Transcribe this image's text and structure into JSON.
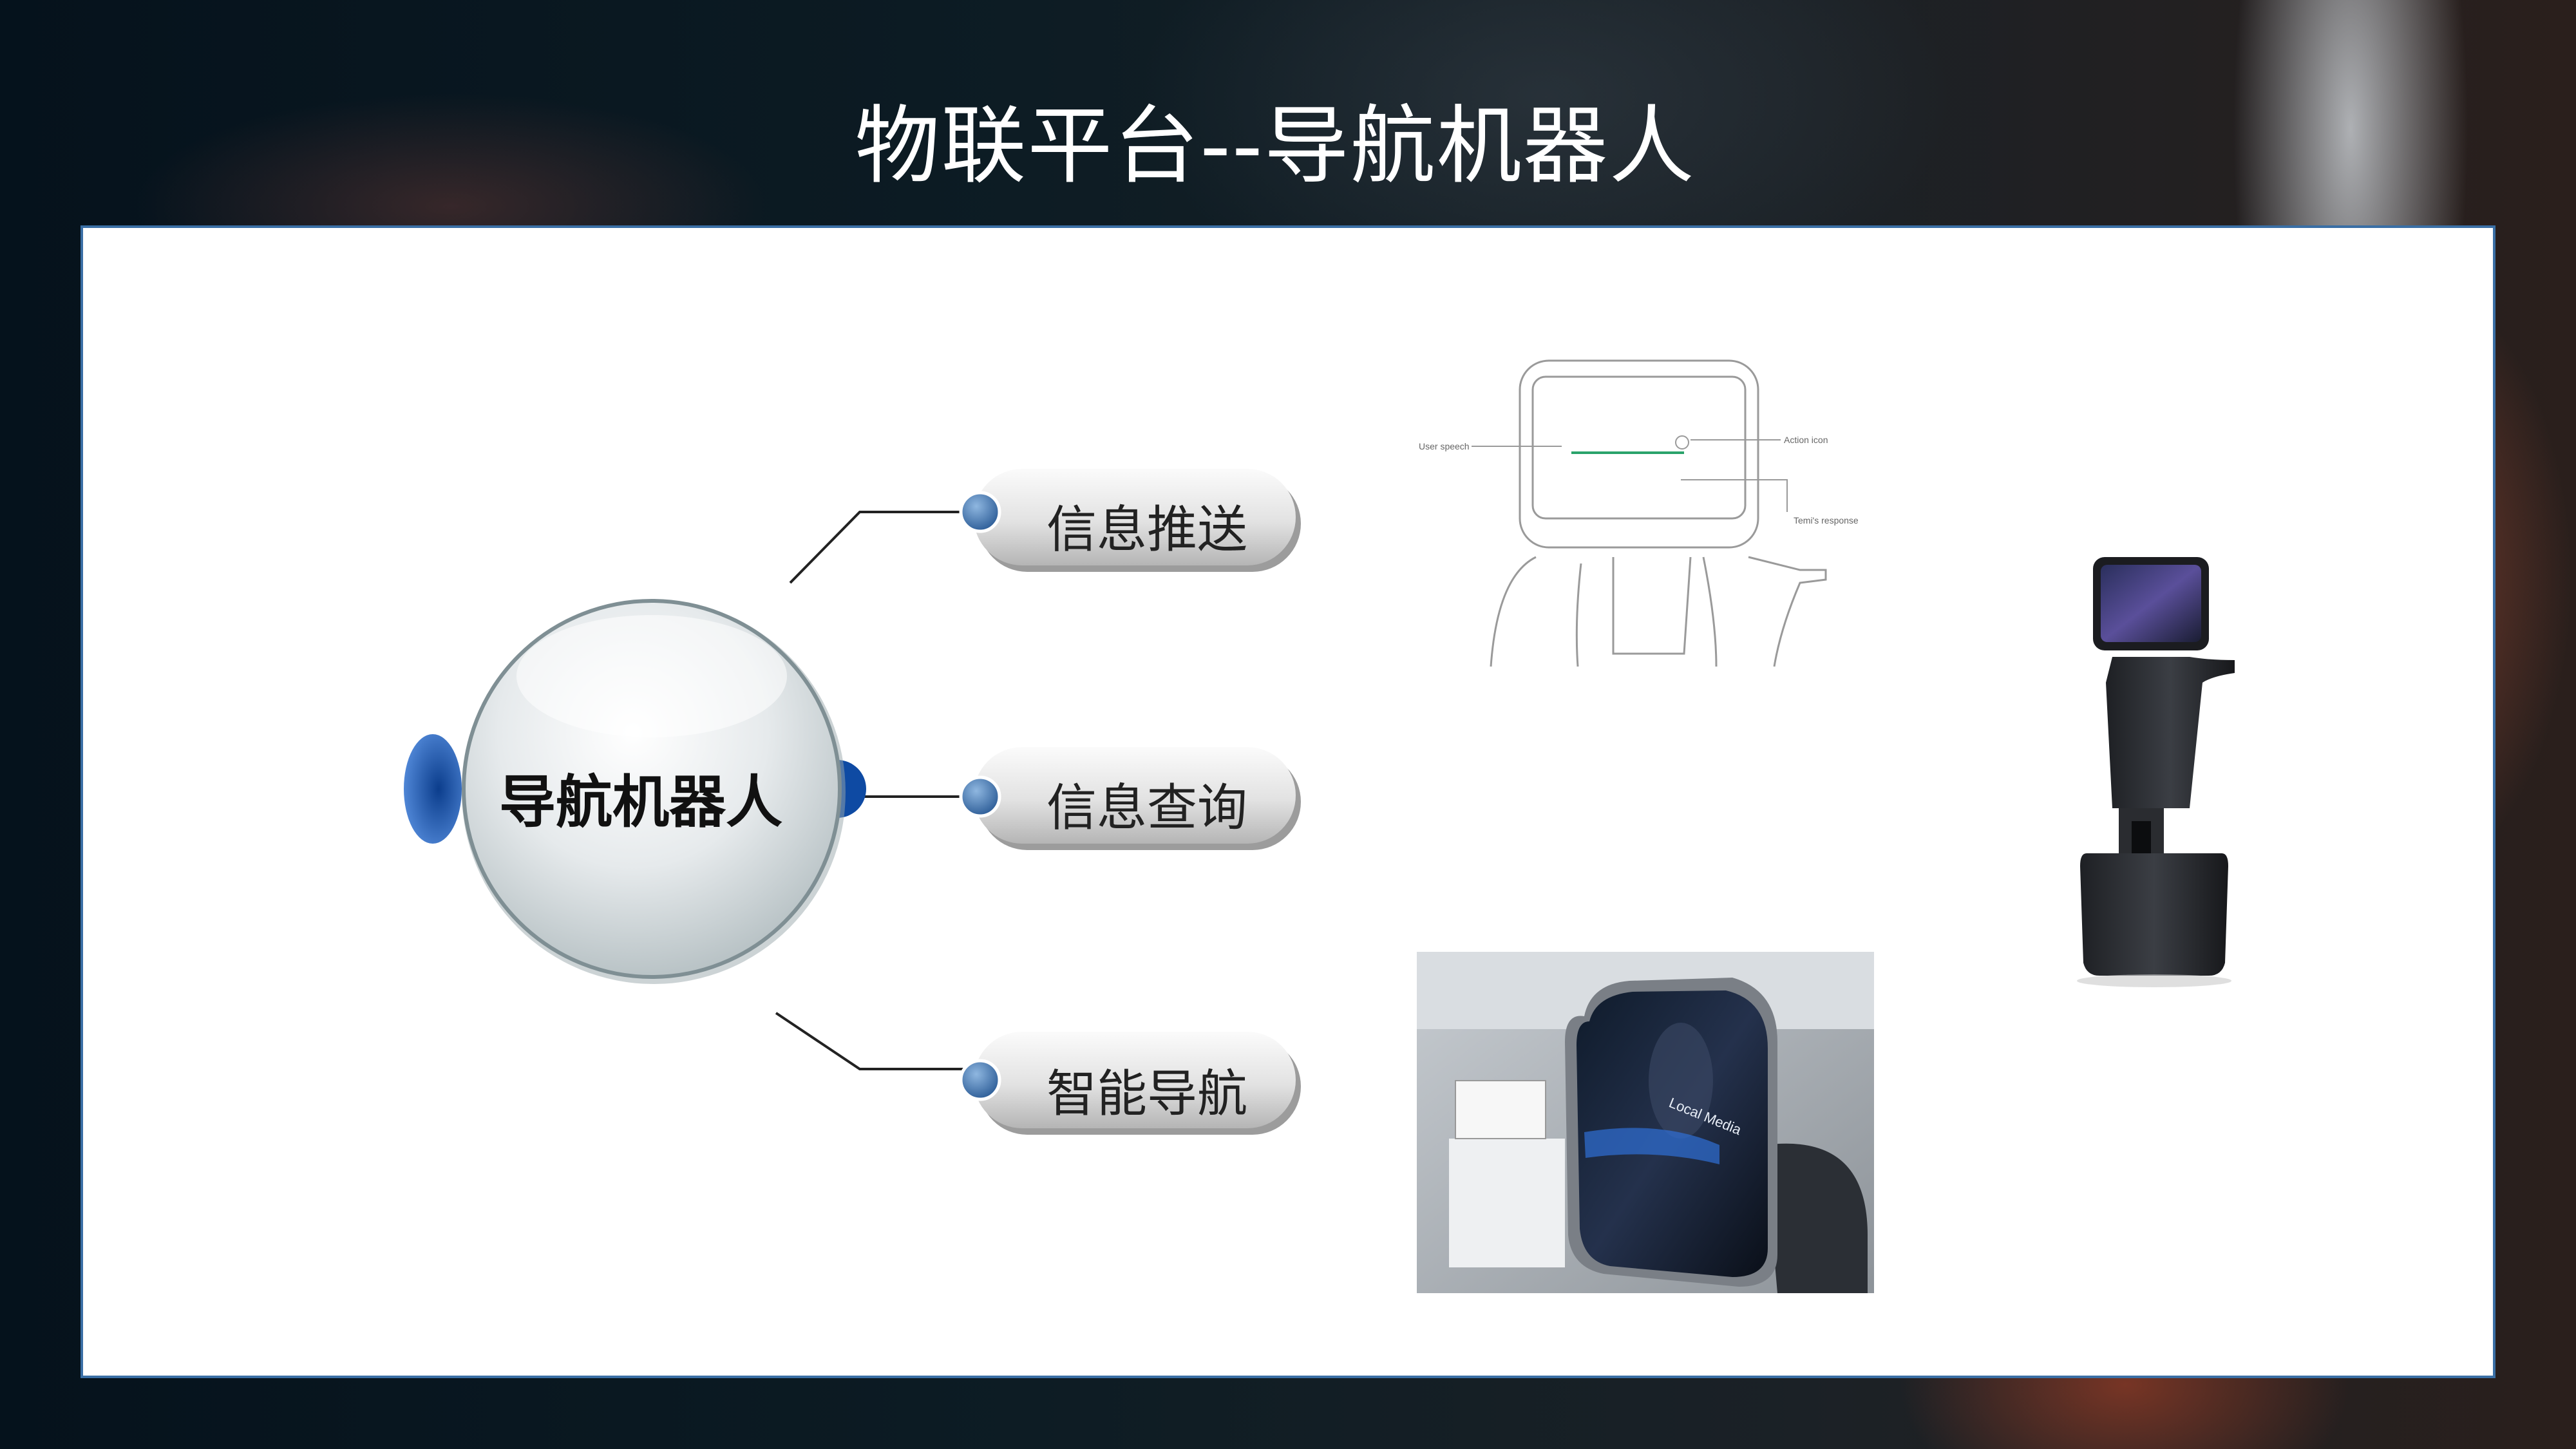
{
  "slide": {
    "title": "物联平台--导航机器人",
    "center_node": "导航机器人",
    "branches": [
      {
        "label": "信息推送"
      },
      {
        "label": "信息查询"
      },
      {
        "label": "智能导航"
      }
    ]
  },
  "sketch": {
    "callout_user_speech": "User speech",
    "callout_action_icon": "Action icon",
    "callout_response": "Temi's response"
  },
  "screen_photo": {
    "overlay_text": "Local Media"
  },
  "colors": {
    "panel_border": "#3a6fa5",
    "node_dot": "#4a7db8",
    "center_accent": "#1a5fb4"
  }
}
